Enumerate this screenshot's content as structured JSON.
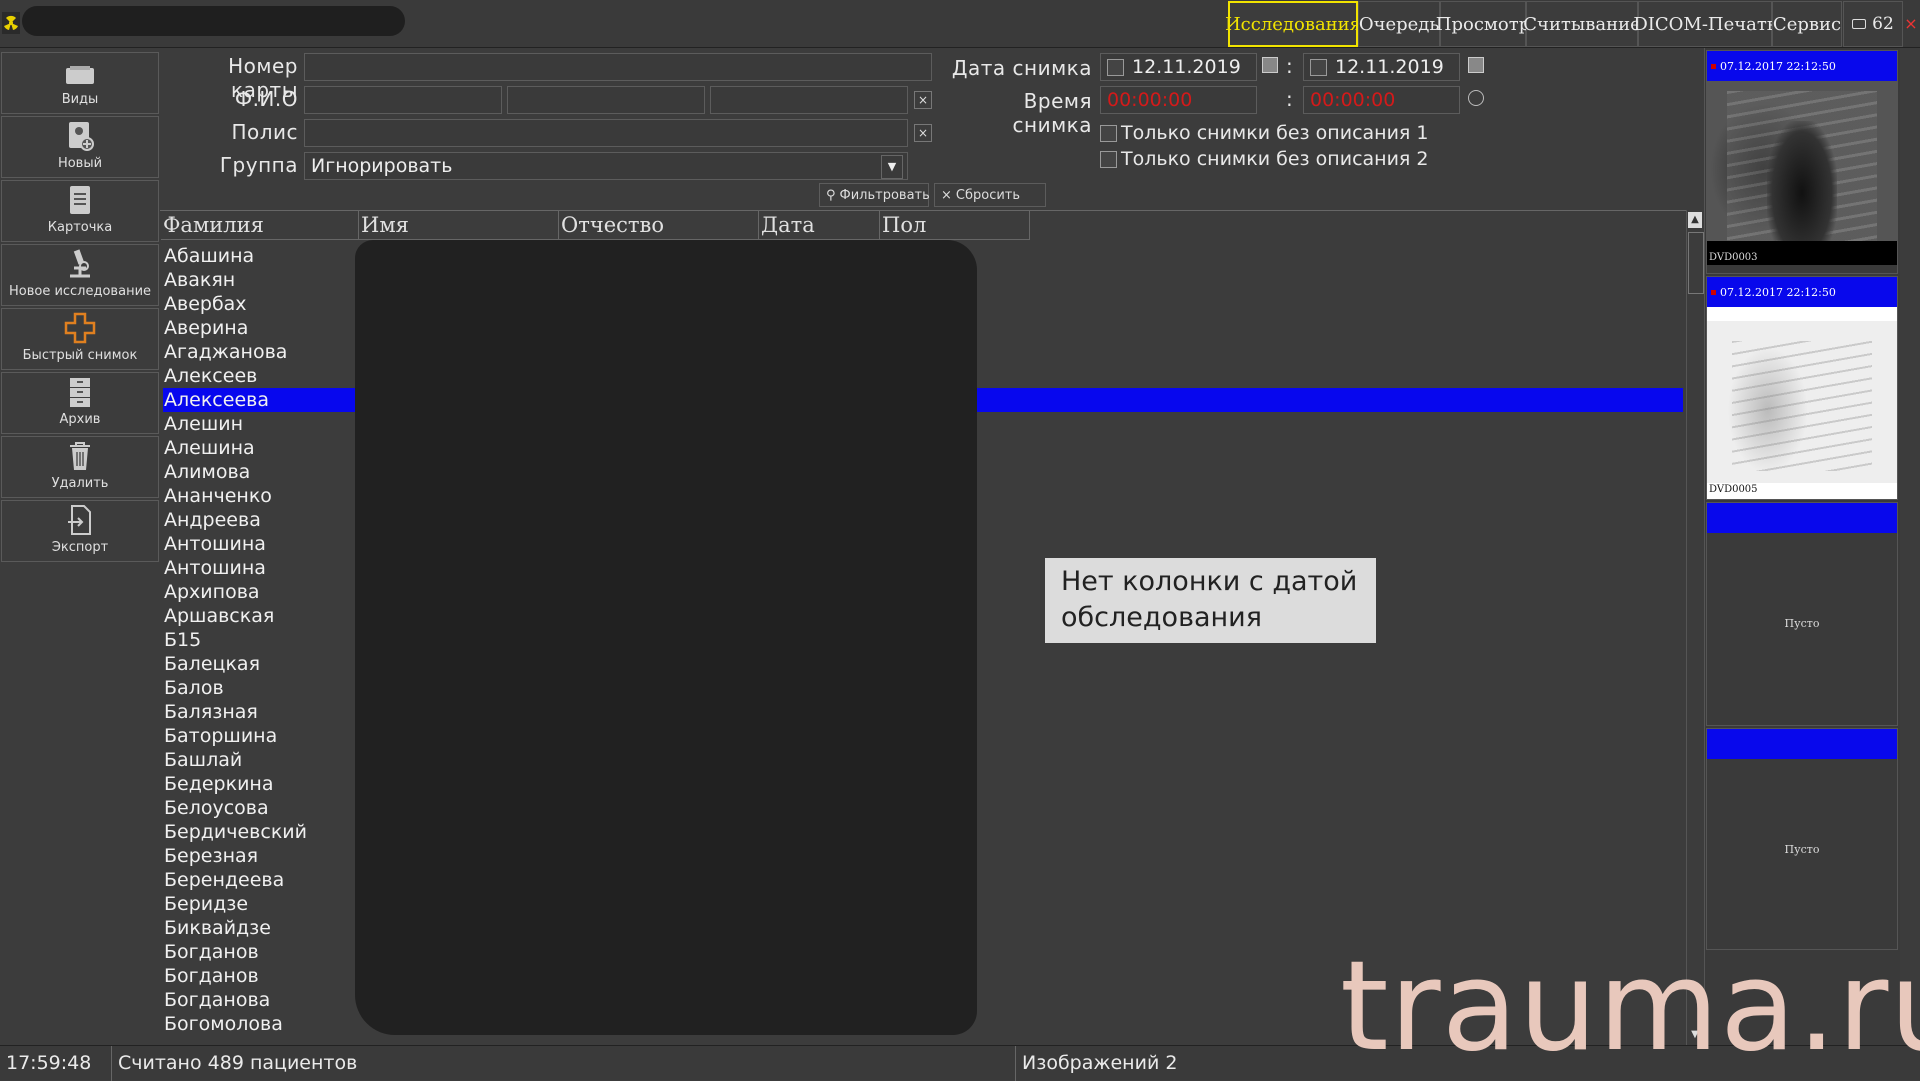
{
  "menu": {
    "items": [
      "Исследования",
      "Очередь",
      "Просмотр",
      "Считывание",
      "DICOM-Печать",
      "Сервис"
    ],
    "active_index": 0,
    "counter": "62",
    "close": "×"
  },
  "sidebar": {
    "items": [
      {
        "label": "Виды",
        "icon": "views-icon"
      },
      {
        "label": "Новый",
        "icon": "new-patient-icon"
      },
      {
        "label": "Карточка",
        "icon": "card-icon"
      },
      {
        "label": "Новое исследование",
        "icon": "microscope-icon"
      },
      {
        "label": "Быстрый снимок",
        "icon": "cross-icon"
      },
      {
        "label": "Архив",
        "icon": "archive-icon"
      },
      {
        "label": "Удалить",
        "icon": "trash-icon"
      },
      {
        "label": "Экспорт",
        "icon": "export-icon"
      }
    ]
  },
  "form": {
    "card_label": "Номер карты",
    "fio_label": "Ф.И.О",
    "policy_label": "Полис",
    "group_label": "Группа",
    "group_value": "Игнорировать",
    "date_label": "Дата снимка",
    "date_from": "12.11.2019",
    "date_to": "12.11.2019",
    "time_label": "Время снимка",
    "time_from": "00:00:00",
    "time_to": "00:00:00",
    "only_no_desc_1": "Только снимки без описания 1",
    "only_no_desc_2": "Только снимки без описания 2",
    "filter_btn": "Фильтровать",
    "reset_btn": "Сбросить",
    "separator": ":"
  },
  "table": {
    "columns": [
      "Фамилия",
      "Имя",
      "Отчество",
      "Дата рожд",
      "Пол"
    ],
    "rows": [
      "Абашина",
      "Авакян",
      "Авербах",
      "Аверина",
      "Агаджанова",
      "Алексеев",
      "Алексеева",
      "Алешин",
      "Алешина",
      "Алимова",
      "Ананченко",
      "Андреева",
      "Антошина",
      "Антошина",
      "Архипова",
      "Аршавская",
      "Б15",
      "Балецкая",
      "Балов",
      "Балязная",
      "Баторшина",
      "Башлай",
      "Бедеркина",
      "Белоусова",
      "Бердичевский",
      "Березная",
      "Берендеева",
      "Беридзе",
      "Биквайдзе",
      "Богданов",
      "Богданов",
      "Богданова",
      "Богомолова"
    ],
    "selected_index": 6
  },
  "tooltip": {
    "line1": "Нет колонки с датой",
    "line2": "обследования"
  },
  "thumbs": [
    {
      "header": "07.12.2017 22:12:50",
      "caption": "DVD0003",
      "empty": false
    },
    {
      "header": "07.12.2017 22:12:50",
      "caption": "DVD0005",
      "empty": false
    },
    {
      "header": "",
      "caption": "",
      "empty": true,
      "empty_text": "Пусто"
    },
    {
      "header": "",
      "caption": "",
      "empty": true,
      "empty_text": "Пусто"
    }
  ],
  "status": {
    "time": "17:59:48",
    "message": "Считано 489 пациентов",
    "images": "Изображений 2"
  },
  "watermark": "trauma.ru",
  "colors": {
    "selection": "#0707ee",
    "active_menu": "#f2e400",
    "time_red": "#d31a1a",
    "thumb_header": "#0808ec"
  }
}
